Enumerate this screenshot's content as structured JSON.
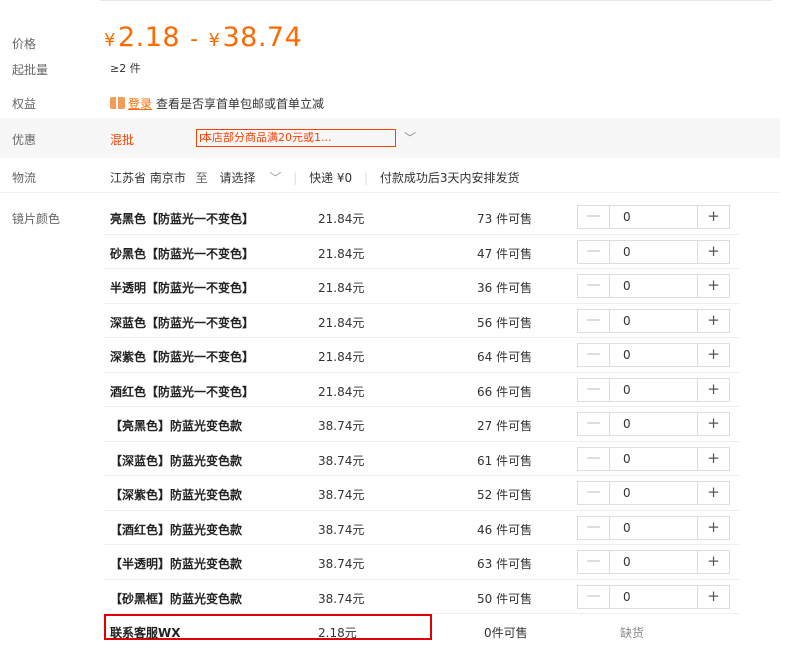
{
  "labels": {
    "price": "价格",
    "min_batch": "起批量",
    "benefit": "权益",
    "promotion": "优惠",
    "logistics": "物流",
    "lens_color": "镜片颜色"
  },
  "price": {
    "currency": "¥",
    "min": "2.18",
    "max": "38.74",
    "separator": "-"
  },
  "min_batch": "≥2 件",
  "benefit": {
    "login_link": "登录",
    "text": "查看是否享首单包邮或首单立减"
  },
  "promotion": {
    "type": "混批",
    "tag": "本店部分商品满20元或1...",
    "expand_icon": "chevron-down-icon"
  },
  "logistics": {
    "origin": "江苏省 南京市",
    "to": "至",
    "destination": "请选择",
    "express": "快递 ¥0",
    "shipping_note": "付款成功后3天内安排发货"
  },
  "colors": {
    "accent": "#ff6a00",
    "promo_red": "#ff4000",
    "highlight_red": "#e00000"
  },
  "skus": [
    {
      "name": "亮黑色【防蓝光一不变色】",
      "price": "21.84元",
      "stock": "73 件可售",
      "qty": "0"
    },
    {
      "name": "砂黑色【防蓝光一不变色】",
      "price": "21.84元",
      "stock": "47 件可售",
      "qty": "0"
    },
    {
      "name": "半透明【防蓝光一不变色】",
      "price": "21.84元",
      "stock": "36 件可售",
      "qty": "0"
    },
    {
      "name": "深蓝色【防蓝光一不变色】",
      "price": "21.84元",
      "stock": "56 件可售",
      "qty": "0"
    },
    {
      "name": "深紫色【防蓝光一不变色】",
      "price": "21.84元",
      "stock": "64 件可售",
      "qty": "0"
    },
    {
      "name": "酒红色【防蓝光一不变色】",
      "price": "21.84元",
      "stock": "66 件可售",
      "qty": "0"
    },
    {
      "name": "【亮黑色】防蓝光变色款",
      "price": "38.74元",
      "stock": "27 件可售",
      "qty": "0"
    },
    {
      "name": "【深蓝色】防蓝光变色款",
      "price": "38.74元",
      "stock": "61 件可售",
      "qty": "0"
    },
    {
      "name": "【深紫色】防蓝光变色款",
      "price": "38.74元",
      "stock": "52 件可售",
      "qty": "0"
    },
    {
      "name": "【酒红色】防蓝光变色款",
      "price": "38.74元",
      "stock": "46 件可售",
      "qty": "0"
    },
    {
      "name": "【半透明】防蓝光变色款",
      "price": "38.74元",
      "stock": "63 件可售",
      "qty": "0"
    },
    {
      "name": "【砂黑框】防蓝光变色款",
      "price": "38.74元",
      "stock": "50 件可售",
      "qty": "0"
    }
  ],
  "contact_sku": {
    "name": "联系客服WX",
    "price": "2.18元",
    "stock": "0件可售",
    "status": "缺货"
  },
  "stepper": {
    "minus": "—",
    "plus": "+"
  }
}
